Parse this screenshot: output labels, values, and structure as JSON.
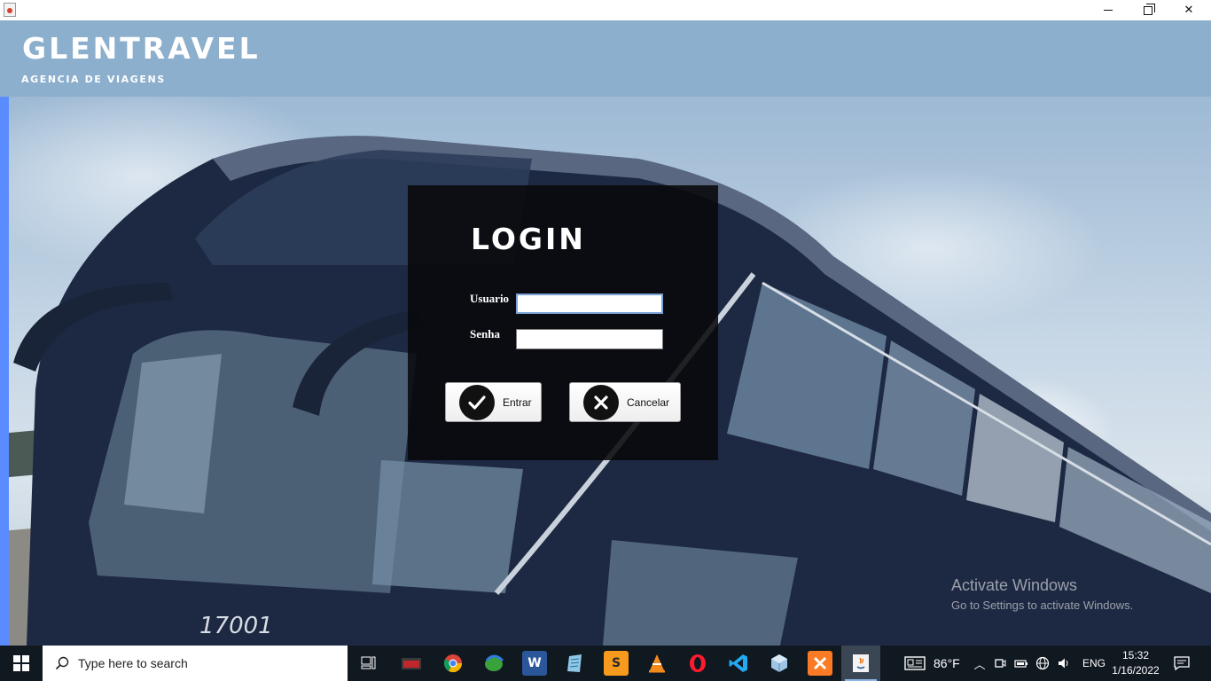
{
  "window": {
    "controls": {
      "minimize": "minimize-icon",
      "maximize": "restore-icon",
      "close": "close-icon"
    }
  },
  "header": {
    "brand": "GLENTRAVEL",
    "tagline": "AGENCIA DE VIAGENS",
    "background_color": "#8cafcd"
  },
  "login": {
    "title": "LOGIN",
    "username_label": "Usuario",
    "username_value": "",
    "password_label": "Senha",
    "password_value": "",
    "enter_button": "Entrar",
    "cancel_button": "Cancelar",
    "panel_color": "#08080a"
  },
  "watermark": {
    "line1": "Activate Windows",
    "line2": "Go to Settings to activate Windows."
  },
  "taskbar": {
    "search_placeholder": "Type here to search",
    "apps": [
      "task-view-icon",
      "file-app-icon",
      "chrome-icon",
      "edge-legacy-icon",
      "word-icon",
      "notepad-icon",
      "sublime-icon",
      "vlc-icon",
      "opera-icon",
      "vscode-icon",
      "virtualbox-icon",
      "xampp-icon",
      "java-icon"
    ],
    "weather": "86°F",
    "language": "ENG",
    "time": "15:32",
    "date": "1/16/2022"
  }
}
